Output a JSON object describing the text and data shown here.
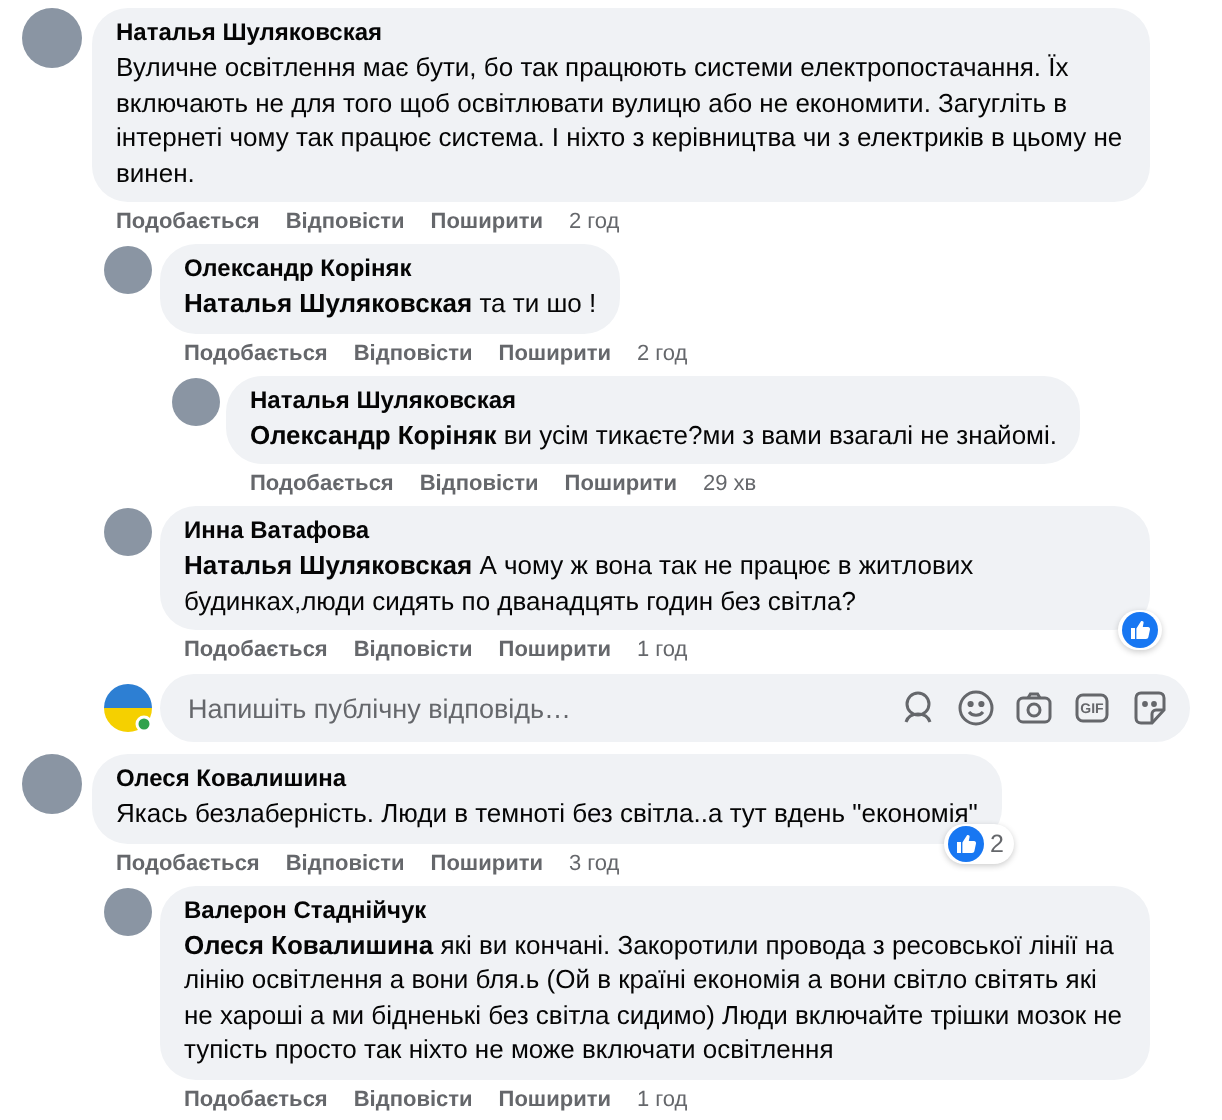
{
  "comments": [
    {
      "author": "Наталья Шуляковская",
      "text": "Вуличне освітлення має бути, бо так працюють системи електропостачання. Їх включають не для того щоб освітлювати вулицю або не економити. Загугліть в інтернеті чому так працює система. І ніхто з керівництва чи з електриків в цьому не винен.",
      "actions": [
        "Подобається",
        "Відповісти",
        "Поширити"
      ],
      "time": "2 год",
      "replies": [
        {
          "author": "Олександр Коріняк",
          "text": "**Наталья Шуляковская** та ти шо !",
          "actions": [
            "Подобається",
            "Відповісти",
            "Поширити"
          ],
          "time": "2 год",
          "replies": [
            {
              "author": "Наталья Шуляковская",
              "text": "**Олександр Коріняк** ви усім тикаєте?ми з вами взагалі не знайомі.",
              "actions": [
                "Подобається",
                "Відповісти",
                "Поширити"
              ],
              "time": "29 хв"
            }
          ]
        },
        {
          "author": "Инна Ватафова",
          "text": "**Наталья Шуляковская** А чому ж вона так не працює в житлових будинках,люди сидять по дванадцять годин без світла?",
          "actions": [
            "Подобається",
            "Відповісти",
            "Поширити"
          ],
          "time": "1 год",
          "reaction": {
            "kind": "like"
          }
        }
      ],
      "reply_box": {
        "placeholder": "Напишіть публічну відповідь…",
        "gif_label": "GIF"
      }
    },
    {
      "author": "Олеся Ковалишина",
      "text": "Якась безлаберність. Люди в темноті без світла..а тут вдень \"економія\"",
      "actions": [
        "Подобається",
        "Відповісти",
        "Поширити"
      ],
      "time": "3 год",
      "reaction": {
        "kind": "like",
        "count": "2"
      },
      "replies": [
        {
          "author": "Валерон Стаднійчук",
          "text": "**Олеся Ковалишина** які ви кончані. Закоротили провода з ресовської лінії на лінію освітлення а вони бля.ь (Ой в країні економія а вони світло світять які не хароші а ми бідненькі без світла сидимо) Люди включайте трішки мозок не тупість просто так ніхто не може включати освітлення",
          "actions": [
            "Подобається",
            "Відповісти",
            "Поширити"
          ],
          "time": "1 год"
        }
      ]
    }
  ]
}
